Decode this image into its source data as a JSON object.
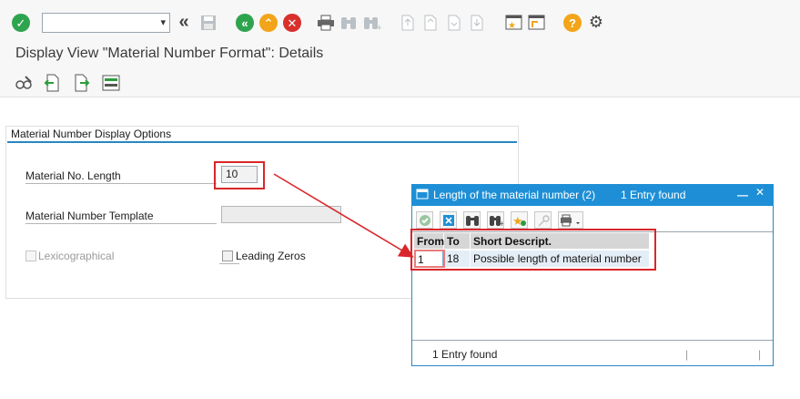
{
  "toolbar": {
    "command_field_value": "",
    "icons": [
      "check-icon",
      "back-double-icon",
      "save-icon",
      "back-icon",
      "exit-icon",
      "cancel-icon",
      "print-icon",
      "find-icon",
      "find-next-icon",
      "first-page-icon",
      "previous-page-icon",
      "next-page-icon",
      "last-page-icon",
      "create-session-icon",
      "generate-shortcut-icon",
      "help-icon",
      "settings-icon"
    ]
  },
  "title": "Display View \"Material Number Format\": Details",
  "subtoolbar": {
    "icons": [
      "display-change-icon",
      "previous-entry-icon",
      "next-entry-icon",
      "variable-list-icon"
    ]
  },
  "group": {
    "title": "Material Number Display Options",
    "fields": {
      "length_label": "Material No. Length",
      "length_value": "10",
      "template_label": "Material Number Template",
      "template_value": "",
      "lexico_label": "Lexicographical",
      "leading_zeros_label": "Leading Zeros"
    }
  },
  "popup": {
    "title": "Length of the material number (2)",
    "found": "1 Entry found",
    "minimize": "—",
    "close": "✕",
    "columns": [
      "From",
      "To",
      "Short Descript."
    ],
    "rows": [
      {
        "from": "1",
        "to": "18",
        "desc": "Possible length of material number"
      }
    ],
    "status": "1 Entry found"
  },
  "colors": {
    "accent": "#1e8fd6",
    "highlight": "#d9262a"
  }
}
